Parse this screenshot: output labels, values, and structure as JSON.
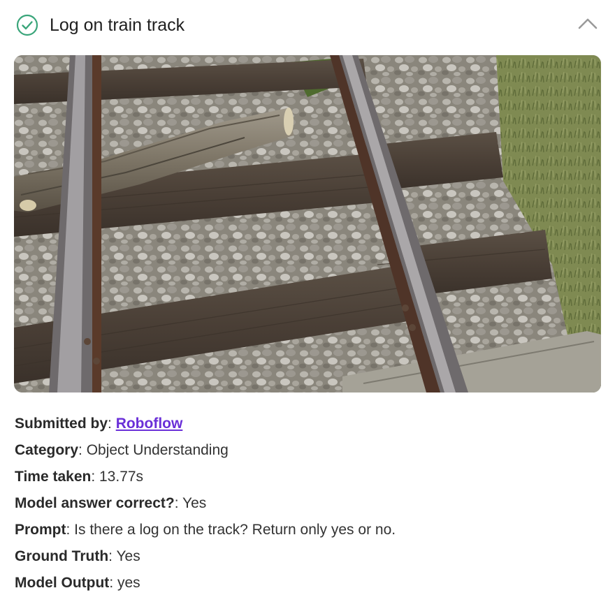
{
  "header": {
    "title": "Log on train track",
    "status_icon": "check-circle-icon",
    "status_color": "#3aa57a",
    "collapse_icon": "chevron-up-icon"
  },
  "image": {
    "subject": "log-on-railway-track"
  },
  "details": {
    "submitted_by_label": "Submitted by",
    "submitted_by_value": "Roboflow",
    "category_label": "Category",
    "category_value": "Object Understanding",
    "time_label": "Time taken",
    "time_value": "13.77s",
    "correct_label": "Model answer correct?",
    "correct_value": "Yes",
    "prompt_label": "Prompt",
    "prompt_value": "Is there a log on the track? Return only yes or no.",
    "truth_label": "Ground Truth",
    "truth_value": "Yes",
    "output_label": "Model Output",
    "output_value": "yes",
    "separator": ": "
  },
  "colors": {
    "link": "#6a2fd8"
  }
}
